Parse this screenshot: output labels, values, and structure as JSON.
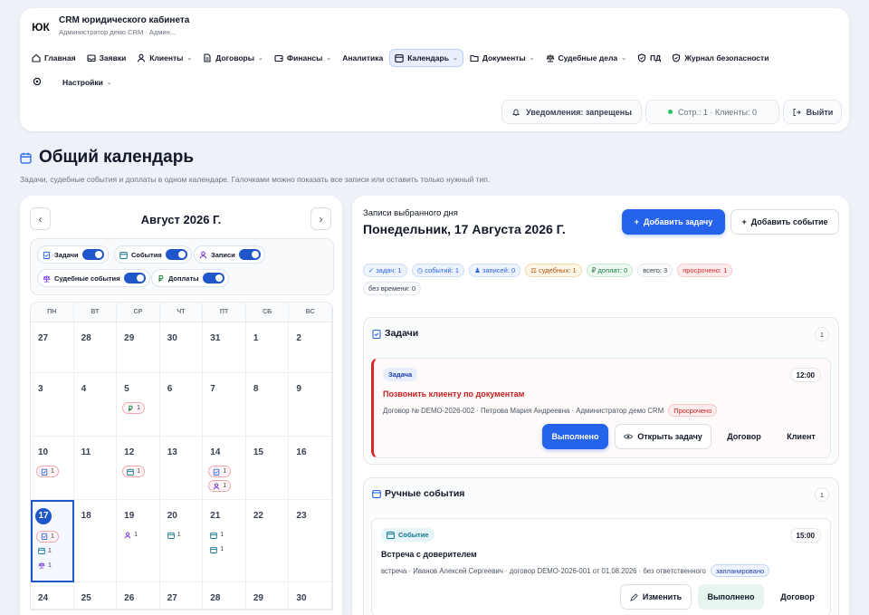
{
  "app": {
    "logo": "ЮК",
    "title": "CRM юридического кабинета",
    "subtitle": "Администратор демо CRM · Админ..."
  },
  "nav": [
    {
      "label": "Главная",
      "icon": "home-icon"
    },
    {
      "label": "Заявки",
      "icon": "inbox-icon"
    },
    {
      "label": "Клиенты",
      "icon": "user-icon",
      "dropdown": true
    },
    {
      "label": "Договоры",
      "icon": "document-icon",
      "dropdown": true
    },
    {
      "label": "Финансы",
      "icon": "wallet-icon",
      "dropdown": true
    },
    {
      "label": "Аналитика"
    },
    {
      "label": "Календарь",
      "icon": "calendar-icon",
      "dropdown": true,
      "active": true
    },
    {
      "label": "Документы",
      "icon": "folder-icon",
      "dropdown": true
    },
    {
      "label": "Судебные дела",
      "icon": "scales-icon",
      "dropdown": true
    },
    {
      "label": "ПД",
      "icon": "shield-icon"
    },
    {
      "label": "Журнал безопасности",
      "icon": "shield-icon"
    }
  ],
  "nav2": {
    "settings_label": "Настройки"
  },
  "header_buttons": {
    "notifications": "Уведомления: запрещены",
    "status": "Сотр.: 1 · Клиенты: 0",
    "logout": "Выйти"
  },
  "page": {
    "title": "Общий календарь",
    "description": "Задачи, судебные события и доплаты в одном календаре. Галочками можно показать все записи или оставить только нужный тип."
  },
  "calendar": {
    "month": "Август 2026 Г.",
    "filters": [
      {
        "label": "Задачи",
        "on": true
      },
      {
        "label": "События",
        "on": true
      },
      {
        "label": "Записи",
        "on": true
      },
      {
        "label": "Судебные события",
        "on": true
      },
      {
        "label": "Доплаты",
        "on": true
      }
    ],
    "weekdays": [
      "ПН",
      "ВТ",
      "СР",
      "ЧТ",
      "ПТ",
      "СБ",
      "ВС"
    ],
    "weeks": [
      [
        {
          "d": "27"
        },
        {
          "d": "28"
        },
        {
          "d": "29"
        },
        {
          "d": "30"
        },
        {
          "d": "31"
        },
        {
          "d": "1"
        },
        {
          "d": "2"
        }
      ],
      [
        {
          "d": "3"
        },
        {
          "d": "4"
        },
        {
          "d": "5",
          "chips": [
            {
              "t": "ruble",
              "n": "1",
              "red": true
            }
          ]
        },
        {
          "d": "6"
        },
        {
          "d": "7"
        },
        {
          "d": "8"
        },
        {
          "d": "9"
        }
      ],
      [
        {
          "d": "10",
          "chips": [
            {
              "t": "task",
              "n": "1",
              "red": true
            }
          ]
        },
        {
          "d": "11"
        },
        {
          "d": "12",
          "chips": [
            {
              "t": "event",
              "n": "1",
              "red": true
            }
          ]
        },
        {
          "d": "13"
        },
        {
          "d": "14",
          "chips": [
            {
              "t": "task",
              "n": "1",
              "red": true
            },
            {
              "t": "person",
              "n": "1",
              "red": true
            }
          ]
        },
        {
          "d": "15"
        },
        {
          "d": "16"
        }
      ],
      [
        {
          "d": "17",
          "sel": true,
          "chips": [
            {
              "t": "task",
              "n": "1",
              "red": true
            },
            {
              "t": "event",
              "n": "1"
            },
            {
              "t": "court",
              "n": "1"
            }
          ]
        },
        {
          "d": "18"
        },
        {
          "d": "19",
          "chips": [
            {
              "t": "person",
              "n": "1"
            }
          ]
        },
        {
          "d": "20",
          "chips": [
            {
              "t": "event",
              "n": "1"
            }
          ]
        },
        {
          "d": "21",
          "chips": [
            {
              "t": "event",
              "n": "1"
            },
            {
              "t": "event",
              "n": "1"
            }
          ]
        },
        {
          "d": "22"
        },
        {
          "d": "23"
        }
      ],
      [
        {
          "d": "24"
        },
        {
          "d": "25"
        },
        {
          "d": "26"
        },
        {
          "d": "27"
        },
        {
          "d": "28"
        },
        {
          "d": "29"
        },
        {
          "d": "30"
        }
      ]
    ]
  },
  "day_panel": {
    "label": "Записи выбранного дня",
    "date": "Понедельник, 17 Августа 2026 Г.",
    "add_task": "Добавить задачу",
    "add_event": "Добавить событие",
    "stats": [
      {
        "label": "✓ задач: 1",
        "color": "#2563eb"
      },
      {
        "label": "◷ событий: 1",
        "color": "#2563eb"
      },
      {
        "label": "♟ записей: 0",
        "color": "#2563eb"
      },
      {
        "label": "⚖ судебных: 1",
        "color": "#b45309"
      },
      {
        "label": "₽ доплат: 0",
        "color": "#15803d"
      },
      {
        "label": "всего: 3",
        "color": "#374151"
      },
      {
        "label": "просрочено: 1",
        "color": "#dc2626"
      },
      {
        "label": "без времени: 0",
        "color": "#374151"
      }
    ],
    "tasks_section": {
      "title": "Задачи",
      "count": "1",
      "item": {
        "tag": "Задача",
        "time": "12:00",
        "title": "Позвонить клиенту по документам",
        "meta": "Договор № DEMO-2026-002 · Петрова Мария Андреевна · Администратор демо CRM",
        "badge": "Просрочено",
        "buttons": {
          "done": "Выполнено",
          "open": "Открыть задачу",
          "contract": "Договор",
          "client": "Клиент"
        }
      }
    },
    "events_section": {
      "title": "Ручные события",
      "count": "1",
      "item": {
        "tag": "Событие",
        "time": "15:00",
        "title": "Встреча с доверителем",
        "meta": "встреча · Иванов Алексей Сергеевич · договор DEMO-2026-001 от 01.08.2026 · без ответственного",
        "badge": "запланировано",
        "buttons": {
          "edit": "Изменить",
          "done": "Выполнено",
          "contract": "Договор"
        }
      }
    }
  }
}
